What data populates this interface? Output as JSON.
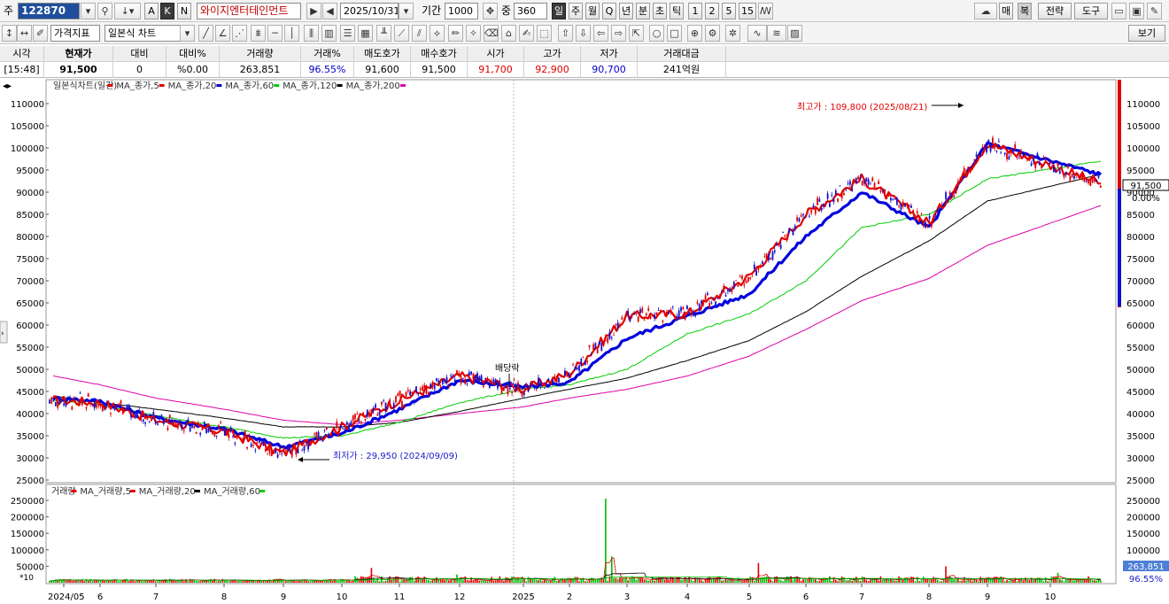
{
  "toolbar1": {
    "market_label": "주",
    "code": "122870",
    "btn_a": "A",
    "btn_k": "K",
    "btn_n": "N",
    "stock_name": "와이지엔터테인먼트",
    "date": "2025/10/31",
    "period_label": "기간",
    "period_value": "1000",
    "center_label": "중",
    "center_value": "360",
    "intervals": [
      "일",
      "주",
      "월",
      "Q",
      "년",
      "분",
      "초",
      "틱",
      "1",
      "2",
      "5",
      "15"
    ],
    "right_buttons": [
      "매",
      "복",
      "전략",
      "도구"
    ]
  },
  "toolbar2": {
    "price_indicator": "가격지표",
    "chart_type": "일본식 차트",
    "view_button": "보기"
  },
  "quote": {
    "headers": [
      "시각",
      "현재가",
      "대비",
      "대비%",
      "거래량",
      "거래%",
      "매도호가",
      "매수호가",
      "시가",
      "고가",
      "저가",
      "거래대금"
    ],
    "values": [
      "[15:48]",
      "91,500",
      "0",
      "%0.00",
      "263,851",
      "96.55%",
      "91,600",
      "91,500",
      "91,700",
      "92,900",
      "90,700",
      "241억원"
    ]
  },
  "price_chart": {
    "legend": [
      {
        "label": "일본식차트(일간)",
        "color": "#e00000"
      },
      {
        "label": "MA_종가,5",
        "color": "#e00000"
      },
      {
        "label": "MA_종가,20",
        "color": "#0000dd"
      },
      {
        "label": "MA_종가,60",
        "color": "#00cc00"
      },
      {
        "label": "MA_종가,120",
        "color": "#000000"
      },
      {
        "label": "MA_종가,200",
        "color": "#dd00aa"
      }
    ],
    "y_ticks": [
      110000,
      105000,
      100000,
      95000,
      90000,
      85000,
      80000,
      75000,
      70000,
      65000,
      60000,
      55000,
      50000,
      45000,
      40000,
      35000,
      30000,
      25000
    ],
    "y_labels": [
      "110000",
      "105000",
      "100000",
      "95000",
      "90000",
      "85000",
      "80000",
      "75000",
      "70000",
      "65000",
      "60000",
      "55000",
      "50000",
      "45000",
      "40000",
      "35000",
      "30000",
      "25000"
    ],
    "current_price_label": "91,500",
    "current_change_label": "0.00%",
    "high_annotation": "최고가 : 109,800 (2025/08/21)",
    "low_annotation": "최저가 : 29,950 (2024/09/09)",
    "dividend_annotation": "배당락"
  },
  "volume_chart": {
    "legend": [
      {
        "label": "거래량",
        "color": "#e00000"
      },
      {
        "label": "MA_거래량,5",
        "color": "#e00000"
      },
      {
        "label": "MA_거래량,20",
        "color": "#000000"
      },
      {
        "label": "MA_거래량,60",
        "color": "#00cc00"
      }
    ],
    "y_labels": [
      "250000",
      "200000",
      "150000",
      "100000",
      "50000"
    ],
    "scale_label": "*10",
    "current_volume_label": "263,851",
    "current_ratio_label": "96.55%"
  },
  "x_axis": {
    "labels": [
      "2024/05",
      "6",
      "7",
      "8",
      "9",
      "10",
      "11",
      "12",
      "2025",
      "2",
      "3",
      "4",
      "5",
      "6",
      "7",
      "8",
      "9",
      "10"
    ]
  },
  "chart_data": {
    "type": "line",
    "title": "",
    "x": [
      "2024/05",
      "2024/06",
      "2024/07",
      "2024/08",
      "2024/09",
      "2024/10",
      "2024/11",
      "2024/12",
      "2025/01",
      "2025/02",
      "2025/03",
      "2025/04",
      "2025/05",
      "2025/06",
      "2025/07",
      "2025/08",
      "2025/09",
      "2025/10"
    ],
    "ylim": [
      25000,
      112000
    ],
    "series": [
      {
        "name": "MA_종가,5",
        "color": "#e00000",
        "values": [
          43000,
          42500,
          38500,
          36000,
          31000,
          37000,
          43000,
          48500,
          45500,
          49000,
          62000,
          62500,
          71000,
          85000,
          93000,
          83000,
          101000,
          92000
        ]
      },
      {
        "name": "MA_종가,20",
        "color": "#0000dd",
        "values": [
          43500,
          42800,
          39000,
          36500,
          32500,
          35500,
          41000,
          47500,
          46000,
          47000,
          57000,
          62000,
          67000,
          80000,
          90000,
          82000,
          101000,
          94000
        ]
      },
      {
        "name": "MA_종가,60",
        "color": "#00cc00",
        "values": [
          43000,
          42000,
          39500,
          37000,
          34500,
          35000,
          38000,
          42500,
          45500,
          46500,
          50000,
          58000,
          62500,
          70000,
          82000,
          85000,
          93000,
          97000
        ]
      },
      {
        "name": "MA_종가,120",
        "color": "#000000",
        "values": [
          44000,
          42500,
          41000,
          39000,
          37000,
          37000,
          38000,
          40500,
          43500,
          45500,
          48000,
          52000,
          56500,
          63000,
          71000,
          79000,
          88000,
          94000
        ]
      },
      {
        "name": "MA_종가,200",
        "color": "#dd00aa",
        "values": [
          48500,
          46500,
          43500,
          41000,
          38500,
          37500,
          38500,
          40000,
          41500,
          43500,
          45500,
          48500,
          53000,
          59000,
          65500,
          70500,
          78000,
          87000
        ]
      }
    ],
    "annotations": [
      "최고가 : 109,800 (2025/08/21)",
      "최저가 : 29,950 (2024/09/09)",
      "배당락"
    ]
  }
}
